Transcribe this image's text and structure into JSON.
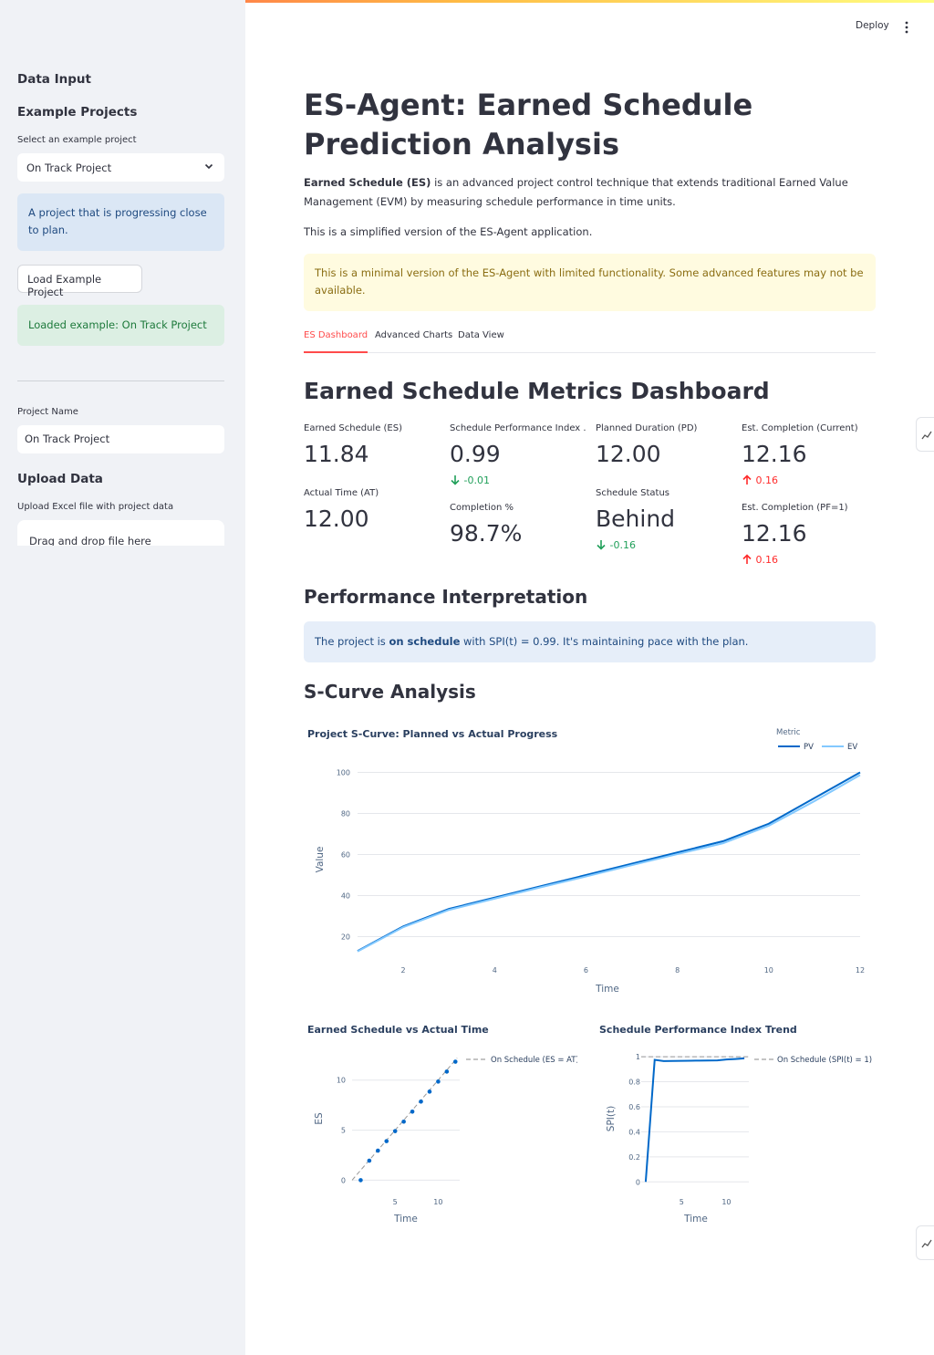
{
  "header": {
    "deploy_label": "Deploy",
    "menu_icon": "kebab-menu-icon"
  },
  "sidebar": {
    "data_input_title": "Data Input",
    "example_projects_title": "Example Projects",
    "select_label": "Select an example project",
    "select_value": "On Track Project",
    "project_description": "A project that is progressing close to plan.",
    "load_button": "Load Example Project",
    "loaded_message": "Loaded example: On Track Project",
    "project_name_label": "Project Name",
    "project_name_value": "On Track Project",
    "upload_title": "Upload Data",
    "upload_label": "Upload Excel file with project data",
    "dropzone_text": "Drag and drop file here"
  },
  "main": {
    "title": "ES-Agent: Earned Schedule Prediction Analysis",
    "intro_bold": "Earned Schedule (ES)",
    "intro_rest": " is an advanced project control technique that extends traditional Earned Value Management (EVM) by measuring schedule performance in time units.",
    "simplified_note": "This is a simplified version of the ES-Agent application.",
    "warning": "This is a minimal version of the ES-Agent with limited functionality. Some advanced features may not be available.",
    "tabs": [
      "ES Dashboard",
      "Advanced Charts",
      "Data View"
    ],
    "active_tab": 0,
    "dashboard_title": "Earned Schedule Metrics Dashboard",
    "metrics": {
      "es": {
        "label": "Earned Schedule (ES)",
        "value": "11.84"
      },
      "spi": {
        "label": "Schedule Performance Index ...",
        "value": "0.99",
        "delta": "-0.01"
      },
      "pd": {
        "label": "Planned Duration (PD)",
        "value": "12.00"
      },
      "ec_current": {
        "label": "Est. Completion (Current)",
        "value": "12.16",
        "delta": "0.16"
      },
      "at": {
        "label": "Actual Time (AT)",
        "value": "12.00"
      },
      "completion": {
        "label": "Completion %",
        "value": "98.7%"
      },
      "status": {
        "label": "Schedule Status",
        "value": "Behind",
        "delta": "-0.16"
      },
      "ec_pf1": {
        "label": "Est. Completion (PF=1)",
        "value": "12.16",
        "delta": "0.16"
      }
    },
    "interpretation_title": "Performance Interpretation",
    "interpretation": {
      "prefix": "The project is ",
      "bold": "on schedule",
      "suffix": " with SPI(t) = 0.99. It's maintaining pace with the plan."
    },
    "scurve_title": "S-Curve Analysis"
  },
  "colors": {
    "accent": "#ff4b4b",
    "pv": "#0068c9",
    "ev": "#83c9ff",
    "green": "#21a05a",
    "red": "#ff2b2b"
  },
  "chart_data": [
    {
      "type": "line",
      "title": "Project S-Curve: Planned vs Actual Progress",
      "xlabel": "Time",
      "ylabel": "Value",
      "legend_title": "Metric",
      "legend_position": "top-right",
      "xlim": [
        1,
        12
      ],
      "ylim": [
        10,
        102
      ],
      "xticks": [
        2,
        4,
        6,
        8,
        10,
        12
      ],
      "yticks": [
        20,
        40,
        60,
        80,
        100
      ],
      "x": [
        1,
        2,
        3,
        4,
        5,
        6,
        7,
        8,
        9,
        10,
        11,
        12
      ],
      "series": [
        {
          "name": "PV",
          "values": [
            13,
            25,
            33.5,
            39,
            44.5,
            50,
            55.5,
            61,
            66.5,
            75,
            87.5,
            100
          ]
        },
        {
          "name": "EV",
          "values": [
            12.8,
            24.6,
            33,
            38.5,
            44,
            49.3,
            54.8,
            60.2,
            65.5,
            74,
            86,
            98.7
          ]
        }
      ]
    },
    {
      "type": "scatter",
      "title": "Earned Schedule vs Actual Time",
      "xlabel": "Time",
      "ylabel": "ES",
      "xlim": [
        0,
        12.5
      ],
      "ylim": [
        -0.6,
        12.8
      ],
      "xticks": [
        5,
        10
      ],
      "yticks": [
        0,
        5,
        10
      ],
      "reference_line": "On Schedule (ES = AT)",
      "x": [
        1,
        2,
        3,
        4,
        5,
        6,
        7,
        8,
        9,
        10,
        11,
        12
      ],
      "series": [
        {
          "values": [
            0,
            1.95,
            2.95,
            3.9,
            4.9,
            5.85,
            6.85,
            7.85,
            8.85,
            9.85,
            10.85,
            11.84
          ]
        }
      ]
    },
    {
      "type": "line",
      "title": "Schedule Performance Index Trend",
      "xlabel": "Time",
      "ylabel": "SPI(t)",
      "xlim": [
        0.5,
        12.5
      ],
      "ylim": [
        -0.02,
        1.03
      ],
      "xticks": [
        5,
        10
      ],
      "yticks": [
        0,
        0.2,
        0.4,
        0.6,
        0.8,
        1
      ],
      "reference_line": "On Schedule (SPI(t) = 1)",
      "x": [
        1,
        2,
        3,
        4,
        5,
        6,
        7,
        8,
        9,
        10,
        11,
        12
      ],
      "series": [
        {
          "values": [
            0,
            0.975,
            0.965,
            0.966,
            0.967,
            0.968,
            0.969,
            0.97,
            0.971,
            0.978,
            0.982,
            0.987
          ]
        }
      ]
    }
  ]
}
